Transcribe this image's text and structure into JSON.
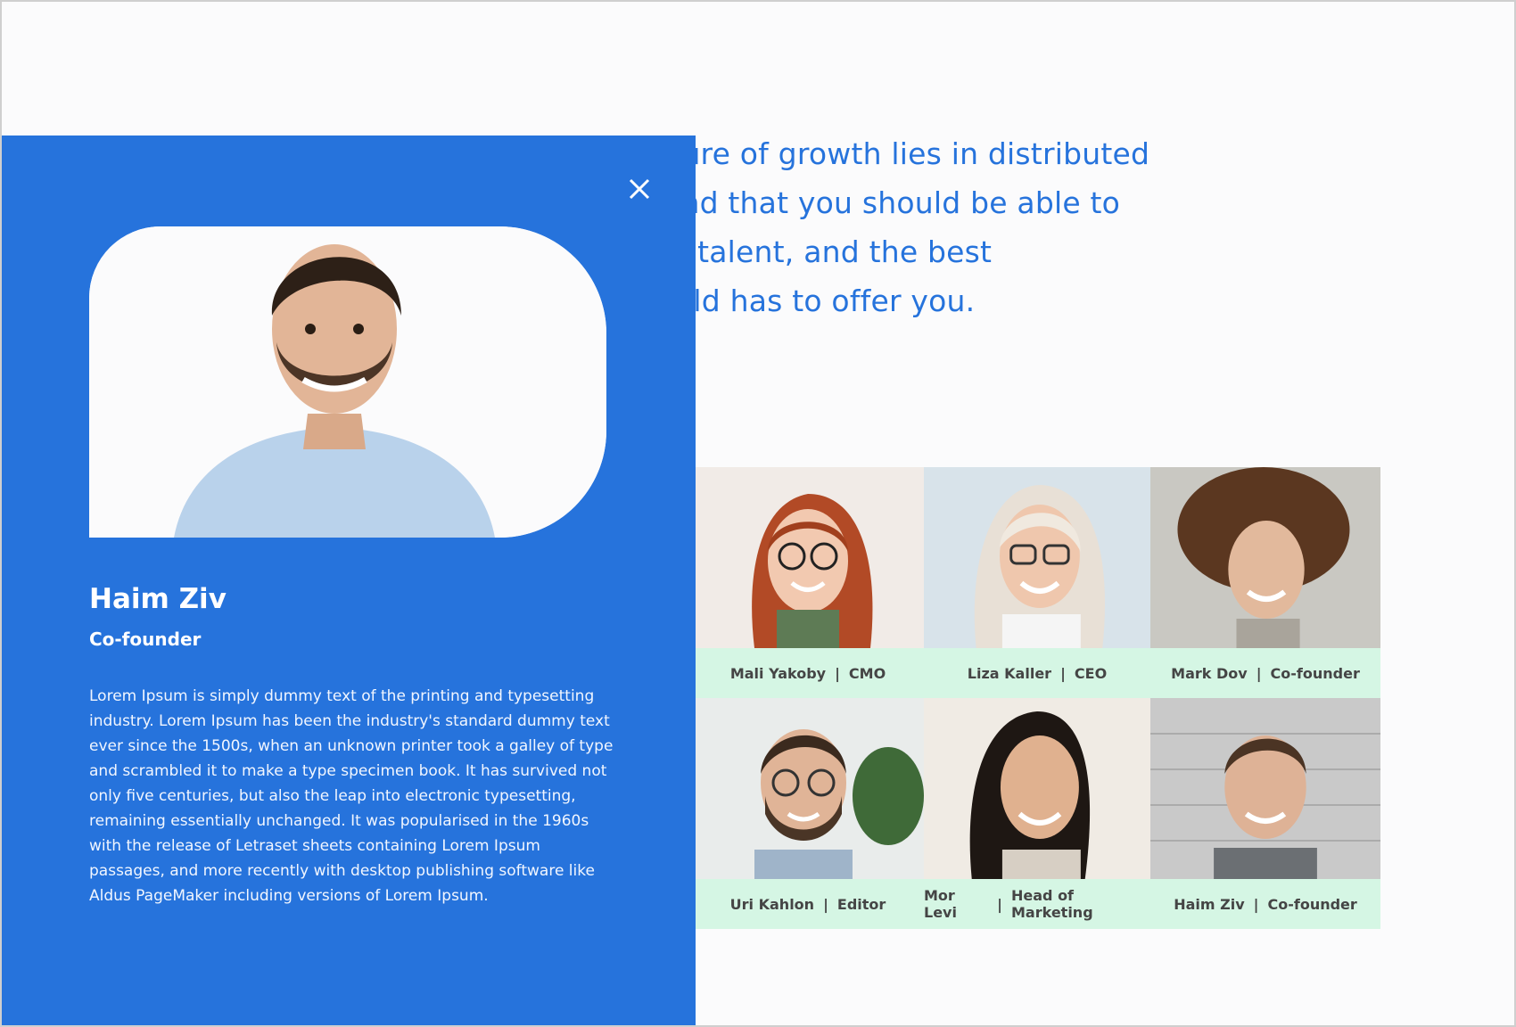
{
  "intro": {
    "lines": [
      "ve the future of growth lies in distributed",
      "g team- and that you should be able to",
      "n the best talent, and the best",
      "es the world has to offer you."
    ]
  },
  "team": [
    {
      "name": "Mali Yakoby",
      "role": "CMO"
    },
    {
      "name": "Liza Kaller",
      "role": "CEO"
    },
    {
      "name": "Mark Dov",
      "role": "Co-founder"
    },
    {
      "name": "Uri Kahlon",
      "role": "Editor"
    },
    {
      "name": "Mor Levi",
      "role": "Head of Marketing"
    },
    {
      "name": "Haim Ziv",
      "role": "Co-founder"
    }
  ],
  "separator": "|",
  "profile": {
    "name": "Haim Ziv",
    "role": "Co-founder",
    "bio": "Lorem Ipsum is simply dummy text of the printing and typesetting industry. Lorem Ipsum has been the industry's standard dummy text ever since the 1500s, when an unknown printer took a galley of type and scrambled it to make a type specimen book. It has survived not only five centuries, but also the leap into electronic typesetting, remaining essentially unchanged. It was popularised in the 1960s with the release of Letraset sheets containing Lorem Ipsum passages, and more recently with desktop publishing software like Aldus PageMaker including versions of Lorem Ipsum."
  },
  "icons": {
    "close": "close-icon"
  },
  "colors": {
    "accent": "#2673dc",
    "caption_bg": "#d5f6e4",
    "page_bg": "#fbfbfc"
  }
}
